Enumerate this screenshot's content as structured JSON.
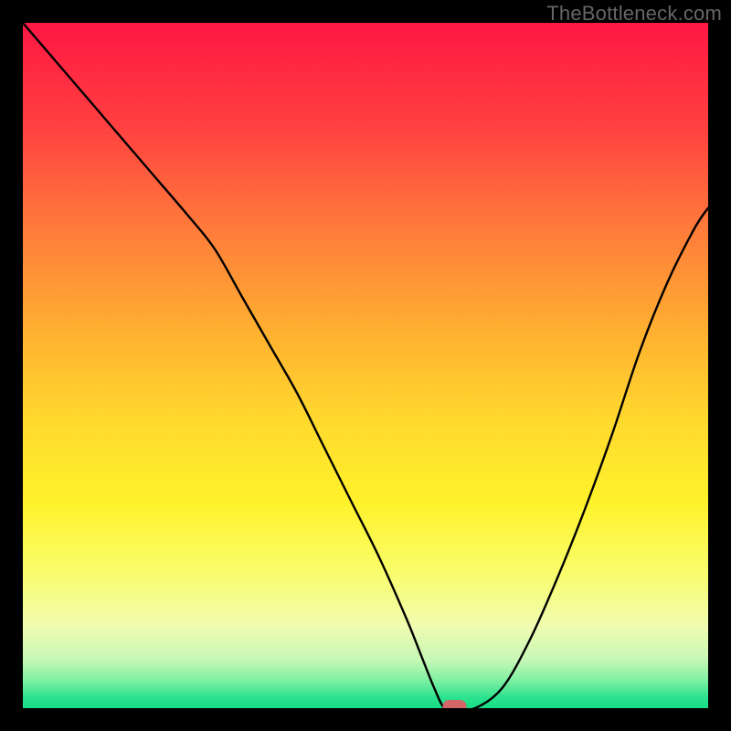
{
  "watermark": "TheBottleneck.com",
  "chart_data": {
    "type": "line",
    "title": "",
    "xlabel": "",
    "ylabel": "",
    "xlim": [
      0,
      100
    ],
    "ylim": [
      0,
      100
    ],
    "x": [
      0,
      6,
      12,
      18,
      24,
      28,
      32,
      36,
      40,
      44,
      48,
      52,
      56,
      58,
      60,
      61.5,
      63,
      66,
      70,
      74,
      78,
      82,
      86,
      90,
      94,
      98,
      100
    ],
    "y": [
      100,
      93,
      86,
      79,
      72,
      67,
      60,
      53,
      46,
      38,
      30,
      22,
      13,
      8,
      3,
      0,
      0,
      0,
      3,
      10,
      19,
      29,
      40,
      52,
      62,
      70,
      73
    ],
    "optimum_x": 63,
    "background": {
      "type": "vertical-gradient",
      "top_color": "#ff1744",
      "stops": [
        {
          "offset": 0.0,
          "color": "#ff1744"
        },
        {
          "offset": 0.15,
          "color": "#ff4040"
        },
        {
          "offset": 0.3,
          "color": "#ff7b3a"
        },
        {
          "offset": 0.45,
          "color": "#ffb030"
        },
        {
          "offset": 0.58,
          "color": "#ffd92e"
        },
        {
          "offset": 0.7,
          "color": "#fff22b"
        },
        {
          "offset": 0.8,
          "color": "#f9fd6a"
        },
        {
          "offset": 0.88,
          "color": "#f0fcb0"
        },
        {
          "offset": 0.93,
          "color": "#c6f7b6"
        },
        {
          "offset": 0.96,
          "color": "#7df0a2"
        },
        {
          "offset": 0.985,
          "color": "#2be28e"
        },
        {
          "offset": 1.0,
          "color": "#17dd85"
        }
      ]
    },
    "marker": {
      "x": 63,
      "y": 0,
      "color": "#d26566",
      "shape": "pill"
    }
  }
}
